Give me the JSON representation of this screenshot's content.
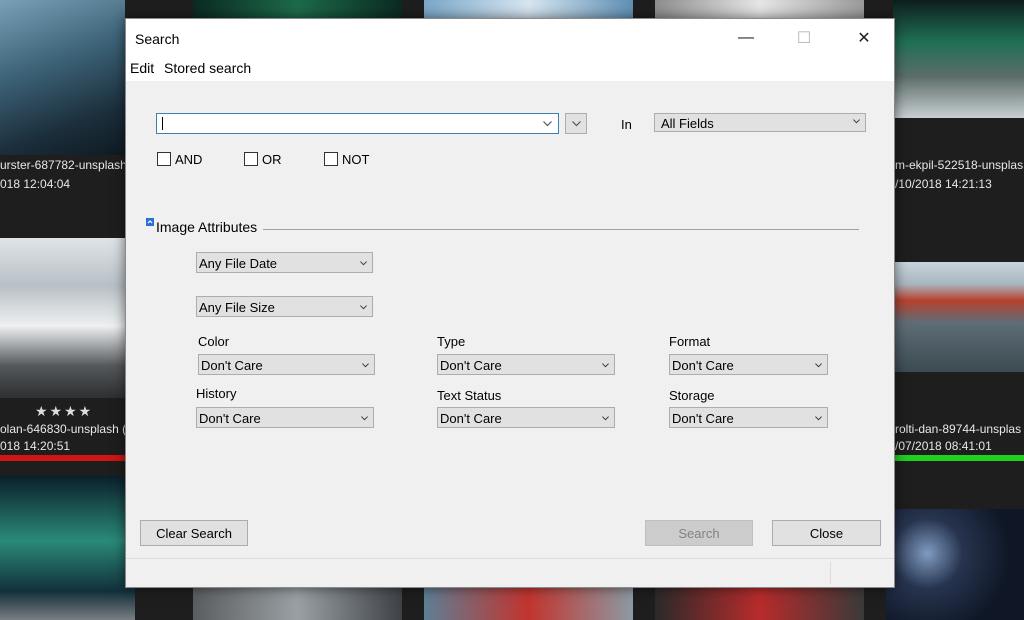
{
  "gallery": {
    "captions": [
      {
        "name": "left-top-filename",
        "text": "urster-687782-unsplash"
      },
      {
        "name": "left-top-date",
        "text": "018 12:04:04"
      },
      {
        "name": "left-mid-filename",
        "text": "olan-646830-unsplash ("
      },
      {
        "name": "left-mid-date",
        "text": "018 14:20:51"
      },
      {
        "name": "right-top-filename",
        "text": "m-ekpil-522518-unsplas"
      },
      {
        "name": "right-top-date",
        "text": "/10/2018 14:21:13"
      },
      {
        "name": "right-mid-filename",
        "text": "rolti-dan-89744-unsplas"
      },
      {
        "name": "right-mid-date",
        "text": "/07/2018 08:41:01"
      }
    ],
    "rating": "★★★★",
    "colors": {
      "red_label": "#d11414",
      "green_label": "#1ed11e"
    }
  },
  "dialog": {
    "title": "Search",
    "window_buttons": {
      "minimize": "—",
      "maximize": "☐",
      "close": "✕"
    },
    "menu": [
      "Edit",
      "Stored search"
    ],
    "search": {
      "value": "",
      "in_label": "In",
      "field_scope": "All Fields"
    },
    "logic": {
      "and": "AND",
      "or": "OR",
      "not": "NOT"
    },
    "section": {
      "label": "Image Attributes",
      "collapse_icon": "collapse-icon"
    },
    "date_filter": "Any File Date",
    "size_filter": "Any File Size",
    "attributes": [
      {
        "label": "Color",
        "value": "Don't Care"
      },
      {
        "label": "Type",
        "value": "Don't Care"
      },
      {
        "label": "Format",
        "value": "Don't Care"
      },
      {
        "label": "History",
        "value": "Don't Care"
      },
      {
        "label": "Text Status",
        "value": "Don't Care"
      },
      {
        "label": "Storage",
        "value": "Don't Care"
      }
    ],
    "buttons": {
      "clear": "Clear Search",
      "search": "Search",
      "close": "Close"
    }
  }
}
